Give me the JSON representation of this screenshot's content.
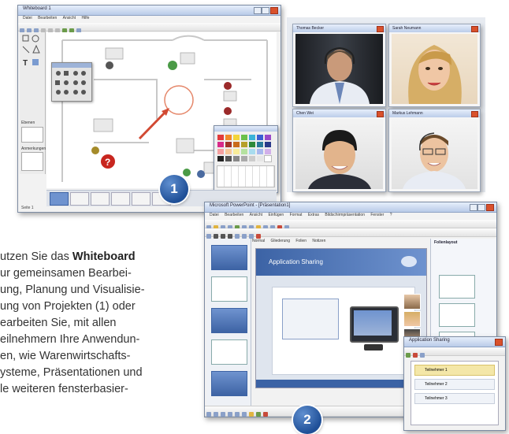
{
  "whiteboard_window": {
    "title": "Whiteboard 1",
    "menu": [
      "Datei",
      "Bearbeiten",
      "Ansicht",
      "Hilfe"
    ],
    "panel_label_1": "Ebenen",
    "panel_label_2": "Anmerkungen",
    "status_text": "Seite 1"
  },
  "video_tiles": [
    {
      "title": "Thomas Becker"
    },
    {
      "title": "Sarah Neumann"
    },
    {
      "title": "Chen Wei"
    },
    {
      "title": "Markus Lehmann"
    }
  ],
  "app_sharing_window": {
    "title": "Microsoft PowerPoint - [Präsentation1]",
    "menu": [
      "Datei",
      "Bearbeiten",
      "Ansicht",
      "Einfügen",
      "Format",
      "Extras",
      "Bildschirmpräsentation",
      "Fenster",
      "?"
    ],
    "slide_title": "Application Sharing",
    "tabs": [
      "Normal",
      "Gliederung",
      "Folien",
      "Notizen"
    ],
    "side_panel_title": "Folienlayout"
  },
  "small_window": {
    "title": "Application Sharing",
    "items": [
      "Teilnehmer 1",
      "Teilnehmer 2",
      "Teilnehmer 3"
    ]
  },
  "badges": [
    "1",
    "2"
  ],
  "description": {
    "line1_prefix": "utzen Sie das ",
    "line1_bold": "Whiteboard",
    "lines": [
      "ur gemeinsamen Bearbei-",
      "ung, Planung und Visualisie-",
      "ung von Projekten (1) oder",
      "earbeiten Sie, mit allen",
      "eilnehmern Ihre Anwendun-",
      "en, wie Warenwirtschafts-",
      "ysteme, Präsentationen und",
      "le weiteren fensterbasier-"
    ]
  },
  "colors": {
    "accent_blue": "#1f4f97",
    "window_chrome": "#b9cbe8",
    "close_red": "#d9512c"
  }
}
